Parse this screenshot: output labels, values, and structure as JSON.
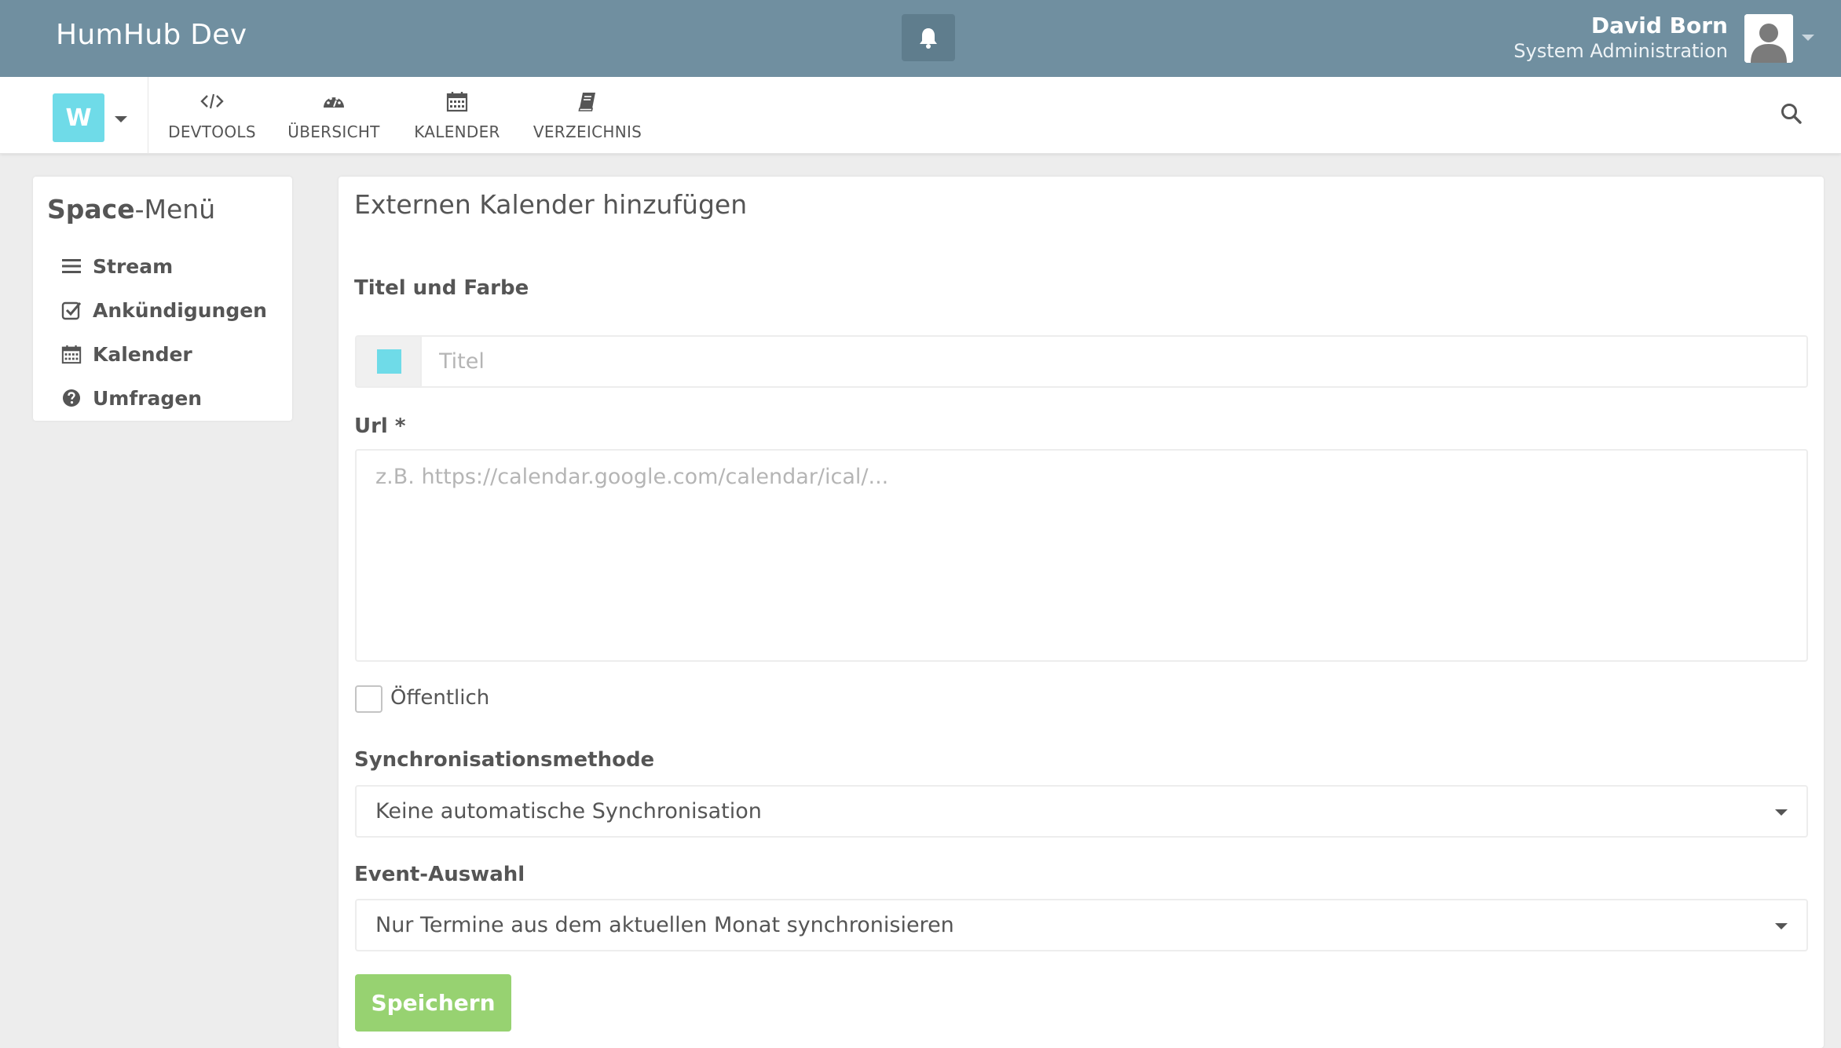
{
  "app": {
    "brand": "HumHub Dev"
  },
  "user": {
    "name": "David Born",
    "role": "System Administration"
  },
  "space": {
    "initial": "W",
    "color": "#6fdbe8"
  },
  "nav": {
    "items": [
      {
        "label": "DEVTOOLS",
        "icon": "code-icon"
      },
      {
        "label": "ÜBERSICHT",
        "icon": "dashboard-icon"
      },
      {
        "label": "KALENDER",
        "icon": "calendar-icon"
      },
      {
        "label": "VERZEICHNIS",
        "icon": "book-icon"
      }
    ]
  },
  "sidebar": {
    "title_bold": "Space",
    "title_rest": "-Menü",
    "items": [
      {
        "label": "Stream",
        "icon": "bars-icon"
      },
      {
        "label": "Ankündigungen",
        "icon": "check-square-icon"
      },
      {
        "label": "Kalender",
        "icon": "calendar-icon"
      },
      {
        "label": "Umfragen",
        "icon": "question-circle-icon"
      }
    ]
  },
  "form": {
    "heading": "Externen Kalender hinzufügen",
    "title_section_label": "Titel und Farbe",
    "title_placeholder": "Titel",
    "title_value": "",
    "color": "#6fdbe8",
    "url_label": "Url *",
    "url_placeholder": "z.B. https://calendar.google.com/calendar/ical/...",
    "public_label": "Öffentlich",
    "public_checked": false,
    "sync_label": "Synchronisationsmethode",
    "sync_value": "Keine automatische Synchronisation",
    "event_label": "Event-Auswahl",
    "event_value": "Nur Termine aus dem aktuellen Monat synchronisieren",
    "save_label": "Speichern"
  },
  "colors": {
    "topbar": "#708fa0",
    "accent": "#6fdbe8",
    "success": "#97d271"
  }
}
